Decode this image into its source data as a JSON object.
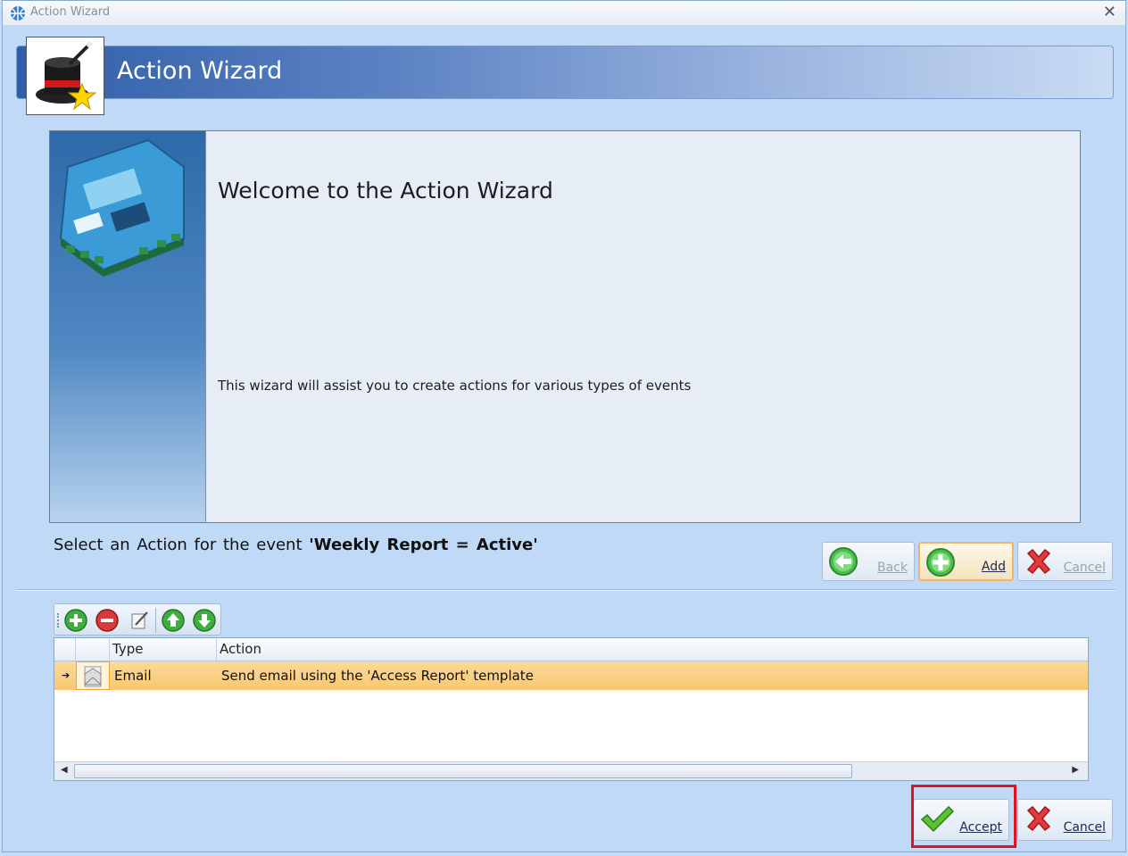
{
  "window": {
    "title": "Action Wizard",
    "close_glyph": "✕"
  },
  "header": {
    "title": "Action Wizard",
    "logo_icon": "magic-hat-icon"
  },
  "welcome": {
    "title": "Welcome to the Action Wizard",
    "description": "This wizard will assist you to create actions for various types of events"
  },
  "event": {
    "prefix": "Select an Action for the event ",
    "name": "'Weekly Report = Active'"
  },
  "nav_buttons": {
    "back": "Back",
    "add": "Add",
    "cancel": "Cancel"
  },
  "toolbar": {
    "icons": [
      "add-icon",
      "remove-icon",
      "edit-icon",
      "move-up-icon",
      "move-down-icon"
    ]
  },
  "grid": {
    "columns": [
      "Type",
      "Action"
    ],
    "rows": [
      {
        "type": "Email",
        "action": "Send email using the 'Access Report' template",
        "icon": "email-icon"
      }
    ]
  },
  "footer_buttons": {
    "accept": "Accept",
    "cancel": "Cancel"
  },
  "colors": {
    "banner_start": "#2f5ea8",
    "selected_row": "#f8c870",
    "highlight": "#e0141c"
  }
}
